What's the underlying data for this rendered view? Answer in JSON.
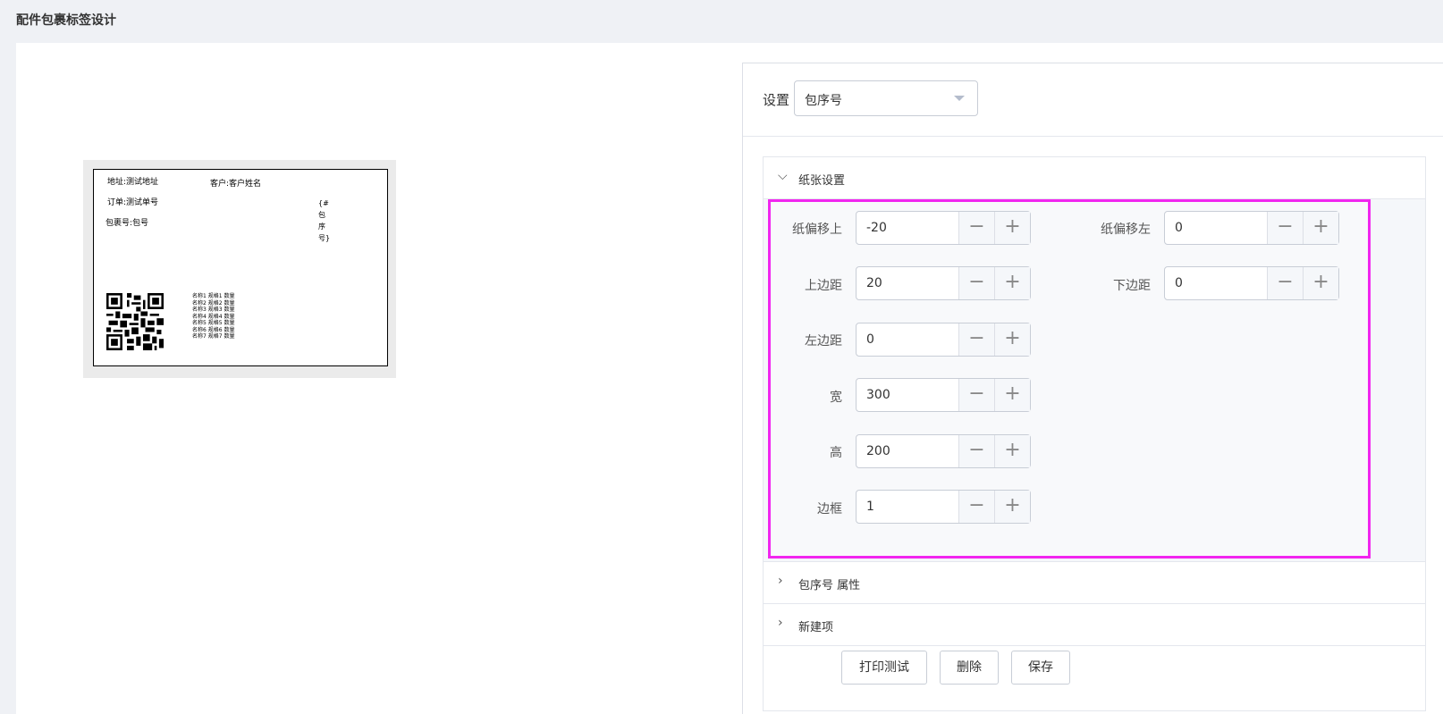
{
  "page": {
    "title": "配件包裹标签设计"
  },
  "preview": {
    "address": "地址:测试地址",
    "customer": "客户:客户姓名",
    "order": "订单:测试单号",
    "package": "包裹号:包号",
    "vertical_chars": [
      "{#",
      "包",
      "序",
      "号}"
    ],
    "items": [
      "名称1 规格1 数量",
      "名称2 规格2 数量",
      "名称3 规格3 数量",
      "名称4 规格4 数量",
      "名称5 规格5 数量",
      "名称6 规格6 数量",
      "名称7 规格7 数量"
    ]
  },
  "settings": {
    "label": "设置",
    "select_value": "包序号",
    "sections": {
      "paper": "纸张设置",
      "props": "包序号 属性",
      "newitem": "新建项"
    },
    "fields": {
      "offset_top": {
        "label": "纸偏移上",
        "value": "-20"
      },
      "offset_left": {
        "label": "纸偏移左",
        "value": "0"
      },
      "margin_top": {
        "label": "上边距",
        "value": "20"
      },
      "margin_bottom": {
        "label": "下边距",
        "value": "0"
      },
      "margin_left": {
        "label": "左边距",
        "value": "0"
      },
      "width": {
        "label": "宽",
        "value": "300"
      },
      "height": {
        "label": "高",
        "value": "200"
      },
      "border": {
        "label": "边框",
        "value": "1"
      }
    },
    "buttons": {
      "print_test": "打印测试",
      "delete": "删除",
      "save": "保存"
    },
    "stepper_symbols": {
      "minus": "−",
      "plus": "+"
    }
  },
  "colors": {
    "highlight": "#f126ef",
    "page_bg": "#eff1f5"
  }
}
